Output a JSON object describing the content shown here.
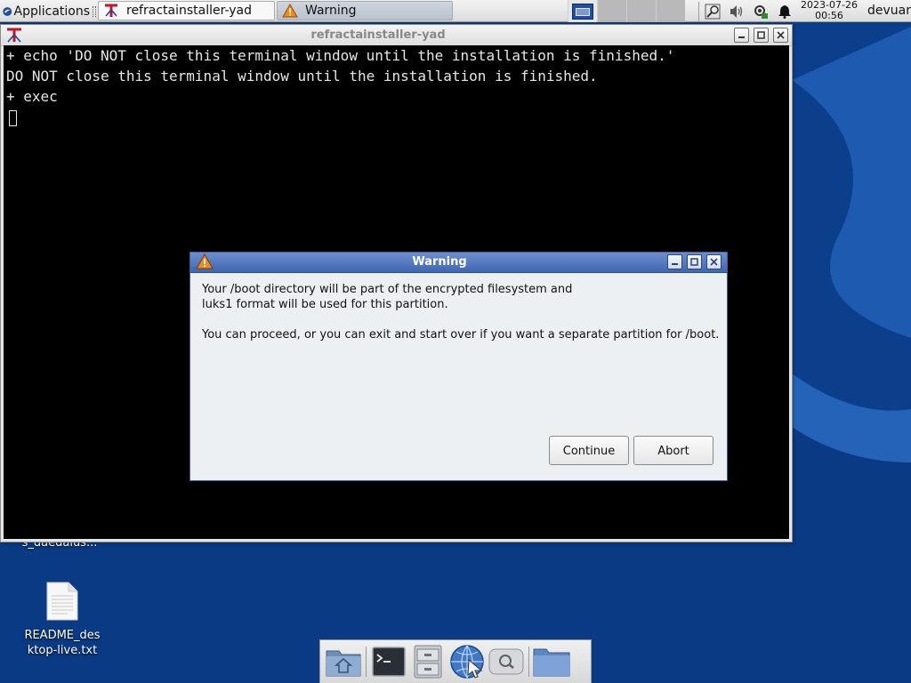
{
  "desktop": {
    "background_color": "#0b3f8c",
    "icons": [
      {
        "label": "s_daedalus...",
        "icon": "file-icon"
      },
      {
        "label_line1": "README_des",
        "label_line2": "ktop-live.txt",
        "icon": "text-file-icon"
      }
    ]
  },
  "top_panel": {
    "applications_label": "Applications",
    "tasks": [
      {
        "title": "refractainstaller-yad",
        "icon": "refracta-icon"
      },
      {
        "title": "Warning",
        "icon": "warning-icon"
      }
    ],
    "clock_date": "2023-07-26",
    "clock_time": "00:56",
    "user": "devuan"
  },
  "terminal": {
    "title": "refractainstaller-yad",
    "lines": [
      "+ echo 'DO NOT close this terminal window until the installation is finished.'",
      "DO NOT close this terminal window until the installation is finished.",
      "+ exec"
    ]
  },
  "dialog": {
    "title": "Warning",
    "message_line1": "Your /boot directory will be part of the encrypted filesystem and",
    "message_line2": "luks1 format will be used for this partition.",
    "message_line3": "You can proceed, or you can exit and start over if you want a separate partition for /boot.",
    "continue_label": "Continue",
    "abort_label": "Abort",
    "title_color": "#3e66b3"
  },
  "dock": {
    "items": [
      "home-folder-icon",
      "terminal-icon",
      "file-manager-icon",
      "web-browser-icon",
      "search-icon",
      "folder-icon"
    ]
  }
}
